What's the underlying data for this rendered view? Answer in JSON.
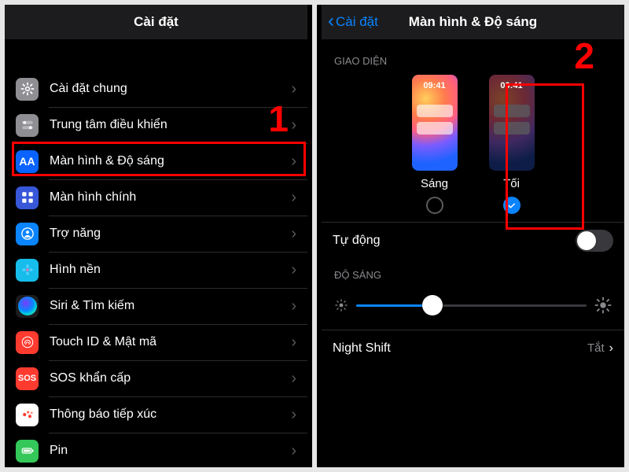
{
  "left": {
    "title": "Cài đặt",
    "items": [
      {
        "id": "general",
        "label": "Cài đặt chung",
        "icon": "gear",
        "bg": "#8e8e93"
      },
      {
        "id": "controlcenter",
        "label": "Trung tâm điều khiển",
        "icon": "switches",
        "bg": "#8e8e93"
      },
      {
        "id": "display",
        "label": "Màn hình & Độ sáng",
        "icon": "AA",
        "bg": "#0a63ff"
      },
      {
        "id": "homescreen",
        "label": "Màn hình chính",
        "icon": "grid",
        "bg": "#3756d8"
      },
      {
        "id": "accessibility",
        "label": "Trợ năng",
        "icon": "person",
        "bg": "#0a84ff"
      },
      {
        "id": "wallpaper",
        "label": "Hình nền",
        "icon": "flower",
        "bg": "#17bdea"
      },
      {
        "id": "siri",
        "label": "Siri & Tìm kiếm",
        "icon": "siri",
        "bg": "#1c1c1e"
      },
      {
        "id": "touchid",
        "label": "Touch ID & Mật mã",
        "icon": "touchid",
        "bg": "#ff3b30"
      },
      {
        "id": "sos",
        "label": "SOS khẩn cấp",
        "icon": "sos",
        "bg": "#ff3b30"
      },
      {
        "id": "exposure",
        "label": "Thông báo tiếp xúc",
        "icon": "dots",
        "bg": "#ffffff"
      },
      {
        "id": "battery",
        "label": "Pin",
        "icon": "battery",
        "bg": "#34c759"
      }
    ],
    "annotation": "1"
  },
  "right": {
    "back": "Cài đặt",
    "title": "Màn hình & Độ sáng",
    "section_appearance": "GIAO DIỆN",
    "appearance": {
      "light_label": "Sáng",
      "dark_label": "Tối",
      "thumb_time": "09:41",
      "selected": "dark"
    },
    "auto_label": "Tự động",
    "auto_on": false,
    "section_brightness": "ĐỘ SÁNG",
    "brightness_percent": 33,
    "night_shift_label": "Night Shift",
    "night_shift_value": "Tắt",
    "annotation": "2"
  },
  "colors": {
    "accent": "#0a84ff",
    "annotation": "#ff0000",
    "text": "#ffffff",
    "secondary": "#8a8a8e"
  }
}
